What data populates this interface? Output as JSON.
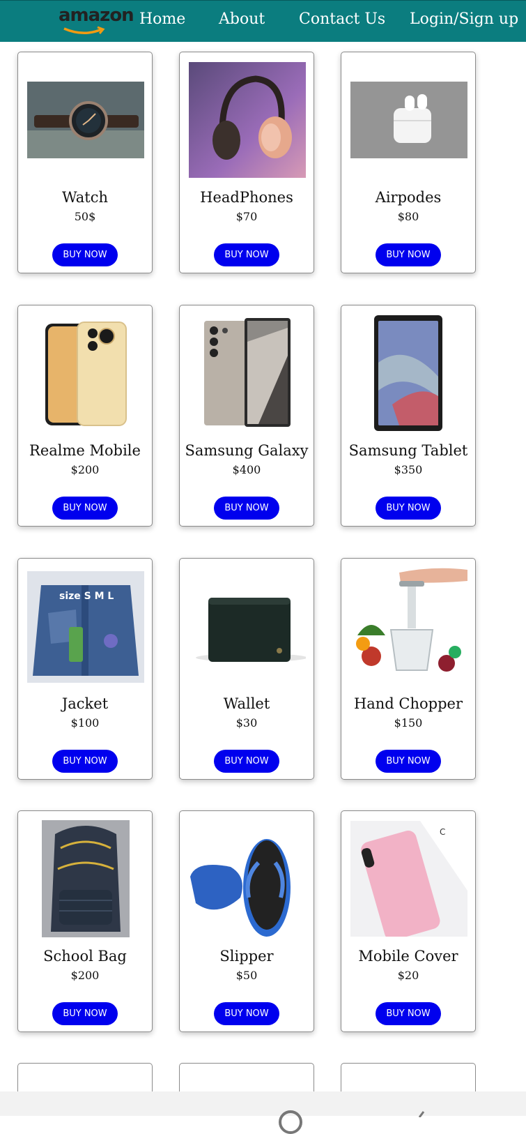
{
  "nav": {
    "logo": "amazon",
    "links": [
      "Home",
      "About",
      "Contact Us",
      "Login/Sign up"
    ]
  },
  "buy_label": "BUY NOW",
  "colors": {
    "navbar": "#0b7d7f",
    "button": "#0000ee",
    "logo_smile": "#f29b12"
  },
  "products": [
    {
      "name": "Watch",
      "price": "50$",
      "image": "watch-image"
    },
    {
      "name": "HeadPhones",
      "price": "$70",
      "image": "headphones-image"
    },
    {
      "name": "Airpodes",
      "price": "$80",
      "image": "airpods-image"
    },
    {
      "name": "Realme Mobile",
      "price": "$200",
      "image": "realme-mobile-image"
    },
    {
      "name": "Samsung Galaxy",
      "price": "$400",
      "image": "samsung-galaxy-image"
    },
    {
      "name": "Samsung Tablet",
      "price": "$350",
      "image": "samsung-tablet-image"
    },
    {
      "name": "Jacket",
      "price": "$100",
      "image": "jacket-image"
    },
    {
      "name": "Wallet",
      "price": "$30",
      "image": "wallet-image"
    },
    {
      "name": "Hand Chopper",
      "price": "$150",
      "image": "hand-chopper-image"
    },
    {
      "name": "School Bag",
      "price": "$200",
      "image": "school-bag-image"
    },
    {
      "name": "Slipper",
      "price": "$50",
      "image": "slipper-image"
    },
    {
      "name": "Mobile Cover",
      "price": "$20",
      "image": "mobile-cover-image"
    }
  ]
}
